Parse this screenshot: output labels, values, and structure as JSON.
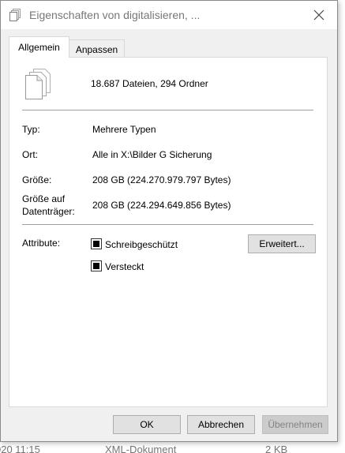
{
  "window": {
    "title": "Eigenschaften von digitalisieren, ..."
  },
  "tabs": [
    {
      "label": "Allgemein",
      "active": true
    },
    {
      "label": "Anpassen",
      "active": false
    }
  ],
  "general": {
    "summary": "18.687 Dateien, 294 Ordner",
    "type_label": "Typ:",
    "type_value": "Mehrere Typen",
    "location_label": "Ort:",
    "location_value": "Alle in X:\\Bilder G Sicherung",
    "size_label": "Größe:",
    "size_value": "208 GB (224.270.979.797 Bytes)",
    "disk_size_label_line1": "Größe auf",
    "disk_size_label_line2": "Datenträger:",
    "disk_size_value": "208 GB (224.294.649.856 Bytes)",
    "attributes_label": "Attribute:",
    "readonly_label": "Schreibgeschützt",
    "readonly_state": "indeterminate",
    "hidden_label": "Versteckt",
    "hidden_state": "indeterminate",
    "advanced_button": "Erweitert..."
  },
  "footer": {
    "ok": "OK",
    "cancel": "Abbrechen",
    "apply": "Übernehmen"
  },
  "background_row": {
    "date": "020 11:15",
    "type": "XML-Dokument",
    "size": "2 KB"
  },
  "colors": {
    "dialog_bg": "#f0f0f0",
    "panel_bg": "#ffffff",
    "button_bg": "#e1e1e1",
    "button_border": "#adadad",
    "disabled_text": "#838383"
  }
}
